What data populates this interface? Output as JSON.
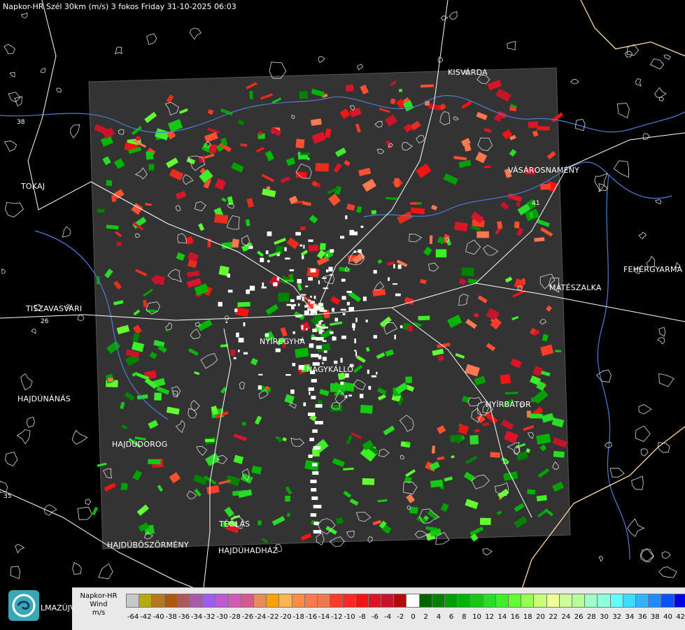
{
  "header": {
    "title": "Napkor-HR Szél 30km (m/s) 3 fokos Friday 31-10-2025 06:03"
  },
  "towns": [
    {
      "id": "kisvarda",
      "label": "KISVÁRDA"
    },
    {
      "id": "tokaj",
      "label": "TOKAJ"
    },
    {
      "id": "vasarosnameny",
      "label": "VÁSÁROSNAMÉNY"
    },
    {
      "id": "fehergyarmat",
      "label": "FEHÉRGYARMA"
    },
    {
      "id": "mateszalka",
      "label": "MÁTÉSZALKA"
    },
    {
      "id": "tiszavasvari",
      "label": "TISZAVASVÁRI"
    },
    {
      "id": "nyiregyhaza",
      "label": "NYÍREGYHÁ"
    },
    {
      "id": "nagykallo",
      "label": "NAGYKÁLLÓ"
    },
    {
      "id": "hajdunanas",
      "label": "HAJDÚNÁNÁS"
    },
    {
      "id": "nyirbator",
      "label": "NYÍRBÁTOR"
    },
    {
      "id": "hajdudorog",
      "label": "HAJDÚDOROG"
    },
    {
      "id": "teglas",
      "label": "TÉGLÁS"
    },
    {
      "id": "hajduboszormeny",
      "label": "HAJDÚBÖSZÖRMÉNY"
    },
    {
      "id": "hajduhadhaz",
      "label": "HAJDÚHADHÁZ"
    }
  ],
  "road_labels": [
    {
      "id": "r38",
      "label": "38"
    },
    {
      "id": "r26",
      "label": "26"
    },
    {
      "id": "r41",
      "label": "41"
    },
    {
      "id": "r35",
      "label": "35"
    }
  ],
  "footer": {
    "logo_text": "LMAZÚJVÁR"
  },
  "legend": {
    "title_lines": [
      "Napkor-HR",
      "Wind",
      "m/s"
    ],
    "ticks": [
      "-64",
      "-42",
      "-40",
      "-38",
      "-36",
      "-34",
      "-32",
      "-30",
      "-28",
      "-26",
      "-24",
      "-22",
      "-20",
      "-18",
      "-16",
      "-14",
      "-12",
      "-10",
      "-8",
      "-6",
      "-4",
      "-2",
      "0",
      "2",
      "4",
      "6",
      "8",
      "10",
      "12",
      "14",
      "16",
      "18",
      "20",
      "22",
      "24",
      "26",
      "28",
      "30",
      "32",
      "34",
      "36",
      "38",
      "40",
      "42"
    ],
    "colors": [
      "#c8c8c8",
      "#b4aa14",
      "#b4781e",
      "#aa5a0a",
      "#aa5a5a",
      "#aa5aaa",
      "#a05af0",
      "#be5ad2",
      "#d25ab4",
      "#d25a8c",
      "#e68c5a",
      "#ffa000",
      "#fab450",
      "#ff8c46",
      "#ff7850",
      "#f07850",
      "#fa3c28",
      "#ff2828",
      "#f01414",
      "#dc1428",
      "#c81428",
      "#b40a0a",
      "#ffffff",
      "#006400",
      "#008200",
      "#00a000",
      "#00b400",
      "#14c814",
      "#28dc28",
      "#3cf028",
      "#64ff32",
      "#96ff50",
      "#c8ff78",
      "#f0ff96",
      "#ccff99",
      "#b4ff9a",
      "#a0ffc8",
      "#8cffdc",
      "#64ffff",
      "#3cdcff",
      "#32b4ff",
      "#1e8cff",
      "#0a50ff",
      "#0000e6"
    ]
  }
}
